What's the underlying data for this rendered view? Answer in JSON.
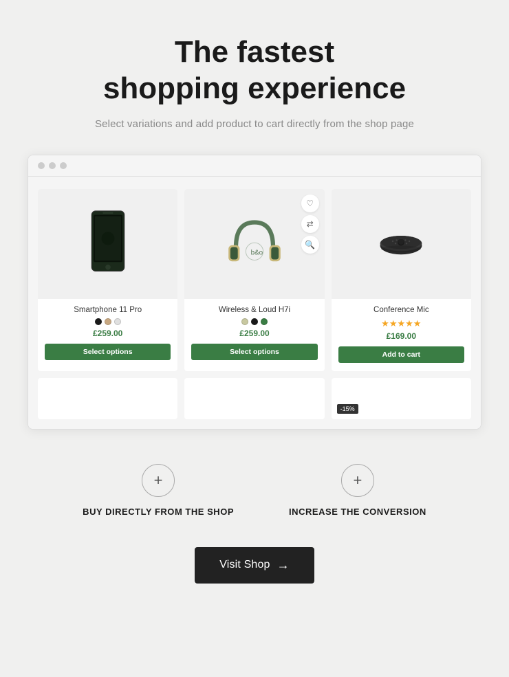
{
  "header": {
    "title_line1": "The fastest",
    "title_line2": "shopping experience",
    "subtitle": "Select variations and add product to cart directly from the shop page"
  },
  "products": [
    {
      "name": "Smartphone 11 Pro",
      "price": "£259.00",
      "swatches": [
        "#1a1a1a",
        "#c8a882",
        "#e0e0e0"
      ],
      "button_label": "Select options",
      "button_type": "select",
      "stars": 0
    },
    {
      "name": "Wireless & Loud H7i",
      "price": "£259.00",
      "swatches": [
        "#c8c8a0",
        "#1a1a1a",
        "#3a7d44"
      ],
      "button_label": "Select options",
      "button_type": "select",
      "stars": 0
    },
    {
      "name": "Conference Mic",
      "price": "£169.00",
      "swatches": [],
      "button_label": "Add to cart",
      "button_type": "add",
      "stars": 5
    }
  ],
  "features": [
    {
      "icon": "+",
      "label": "BUY DIRECTLY FROM THE SHOP"
    },
    {
      "icon": "+",
      "label": "INCREASE THE CONVERSION"
    }
  ],
  "cta": {
    "label": "Visit Shop",
    "arrow": "→"
  }
}
